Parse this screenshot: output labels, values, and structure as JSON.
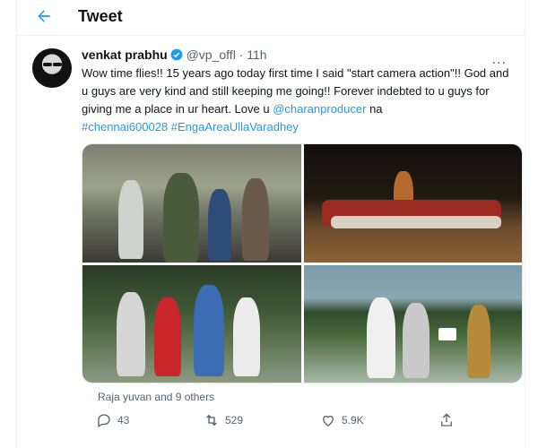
{
  "header": {
    "title": "Tweet",
    "back_icon": "arrow-left-icon"
  },
  "tweet": {
    "author_name": "venkat prabhu",
    "author_handle": "@vp_offl",
    "separator": "·",
    "time": "11h",
    "verified_icon": "verified-badge-icon",
    "more_label": "...",
    "text_part1": "Wow time flies!! 15 years ago today first time I said \"start camera action\"!! God and u guys are very kind and still keeping me going!! Forever indebted to u guys for giving me a place in ur heart. Love u ",
    "mention": "@charanproducer",
    "text_part2": " na",
    "hashtag1": "#chennai600028",
    "hashtag2": "#EngaAreaUllaVaradhey",
    "liked_by": "Raja yuvan and 9 others",
    "actions": {
      "reply_count": "43",
      "retweet_count": "529",
      "like_count": "5.9K",
      "reply_icon": "reply-icon",
      "retweet_icon": "retweet-icon",
      "like_icon": "heart-icon",
      "share_icon": "share-icon"
    }
  },
  "colors": {
    "link": "#1d9bf0",
    "muted": "#536471",
    "text": "#0f1419"
  }
}
